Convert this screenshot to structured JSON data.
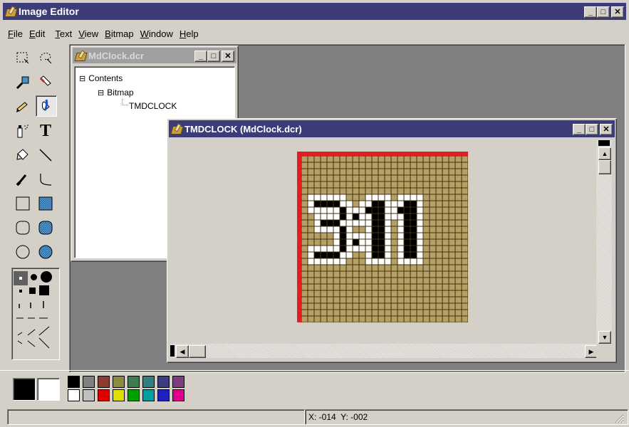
{
  "app": {
    "title": "Image Editor",
    "window_buttons": {
      "minimize": "_",
      "maximize": "□",
      "close": "✕"
    }
  },
  "menu": [
    "File",
    "Edit",
    "Text",
    "View",
    "Bitmap",
    "Window",
    "Help"
  ],
  "tree_window": {
    "title": "MdClock.dcr",
    "items": [
      {
        "label": "Contents",
        "expander": "⊟"
      },
      {
        "label": "Bitmap",
        "expander": "⊟"
      },
      {
        "label": "TMDCLOCK",
        "expander": ""
      }
    ]
  },
  "bitmap_window": {
    "title": "TMDCLOCK (MdClock.dcr)",
    "clock_text": "3:11",
    "colors": {
      "frame": "#e02020",
      "background": "#b4a064",
      "pixel_dark": "#000000",
      "pixel_light": "#ffffff",
      "grid": "#403010"
    }
  },
  "tools": [
    "rect-select-icon",
    "lasso-select-icon",
    "zoom-icon",
    "eraser-icon",
    "pencil-icon",
    "fill-bucket-icon",
    "airbrush-icon",
    "text-icon",
    "color-pick-icon",
    "line-icon",
    "brush-icon",
    "curve-icon",
    "rectangle-icon",
    "filled-rectangle-icon",
    "rounded-rect-icon",
    "filled-rounded-rect-icon",
    "ellipse-icon",
    "filled-ellipse-icon"
  ],
  "palette": {
    "foreground": "#000000",
    "background": "#ffffff",
    "colors_top": [
      "#000000",
      "#808080",
      "#8c3c30",
      "#8c8c3c",
      "#3c7c50",
      "#308080",
      "#3c3c80",
      "#803c80"
    ],
    "colors_bottom": [
      "#ffffff",
      "#c0c0c0",
      "#e00000",
      "#e0e000",
      "#00a000",
      "#00a0a0",
      "#2020c0",
      "#e00090"
    ]
  },
  "status": {
    "coords": "X: -014  Y: -002"
  }
}
